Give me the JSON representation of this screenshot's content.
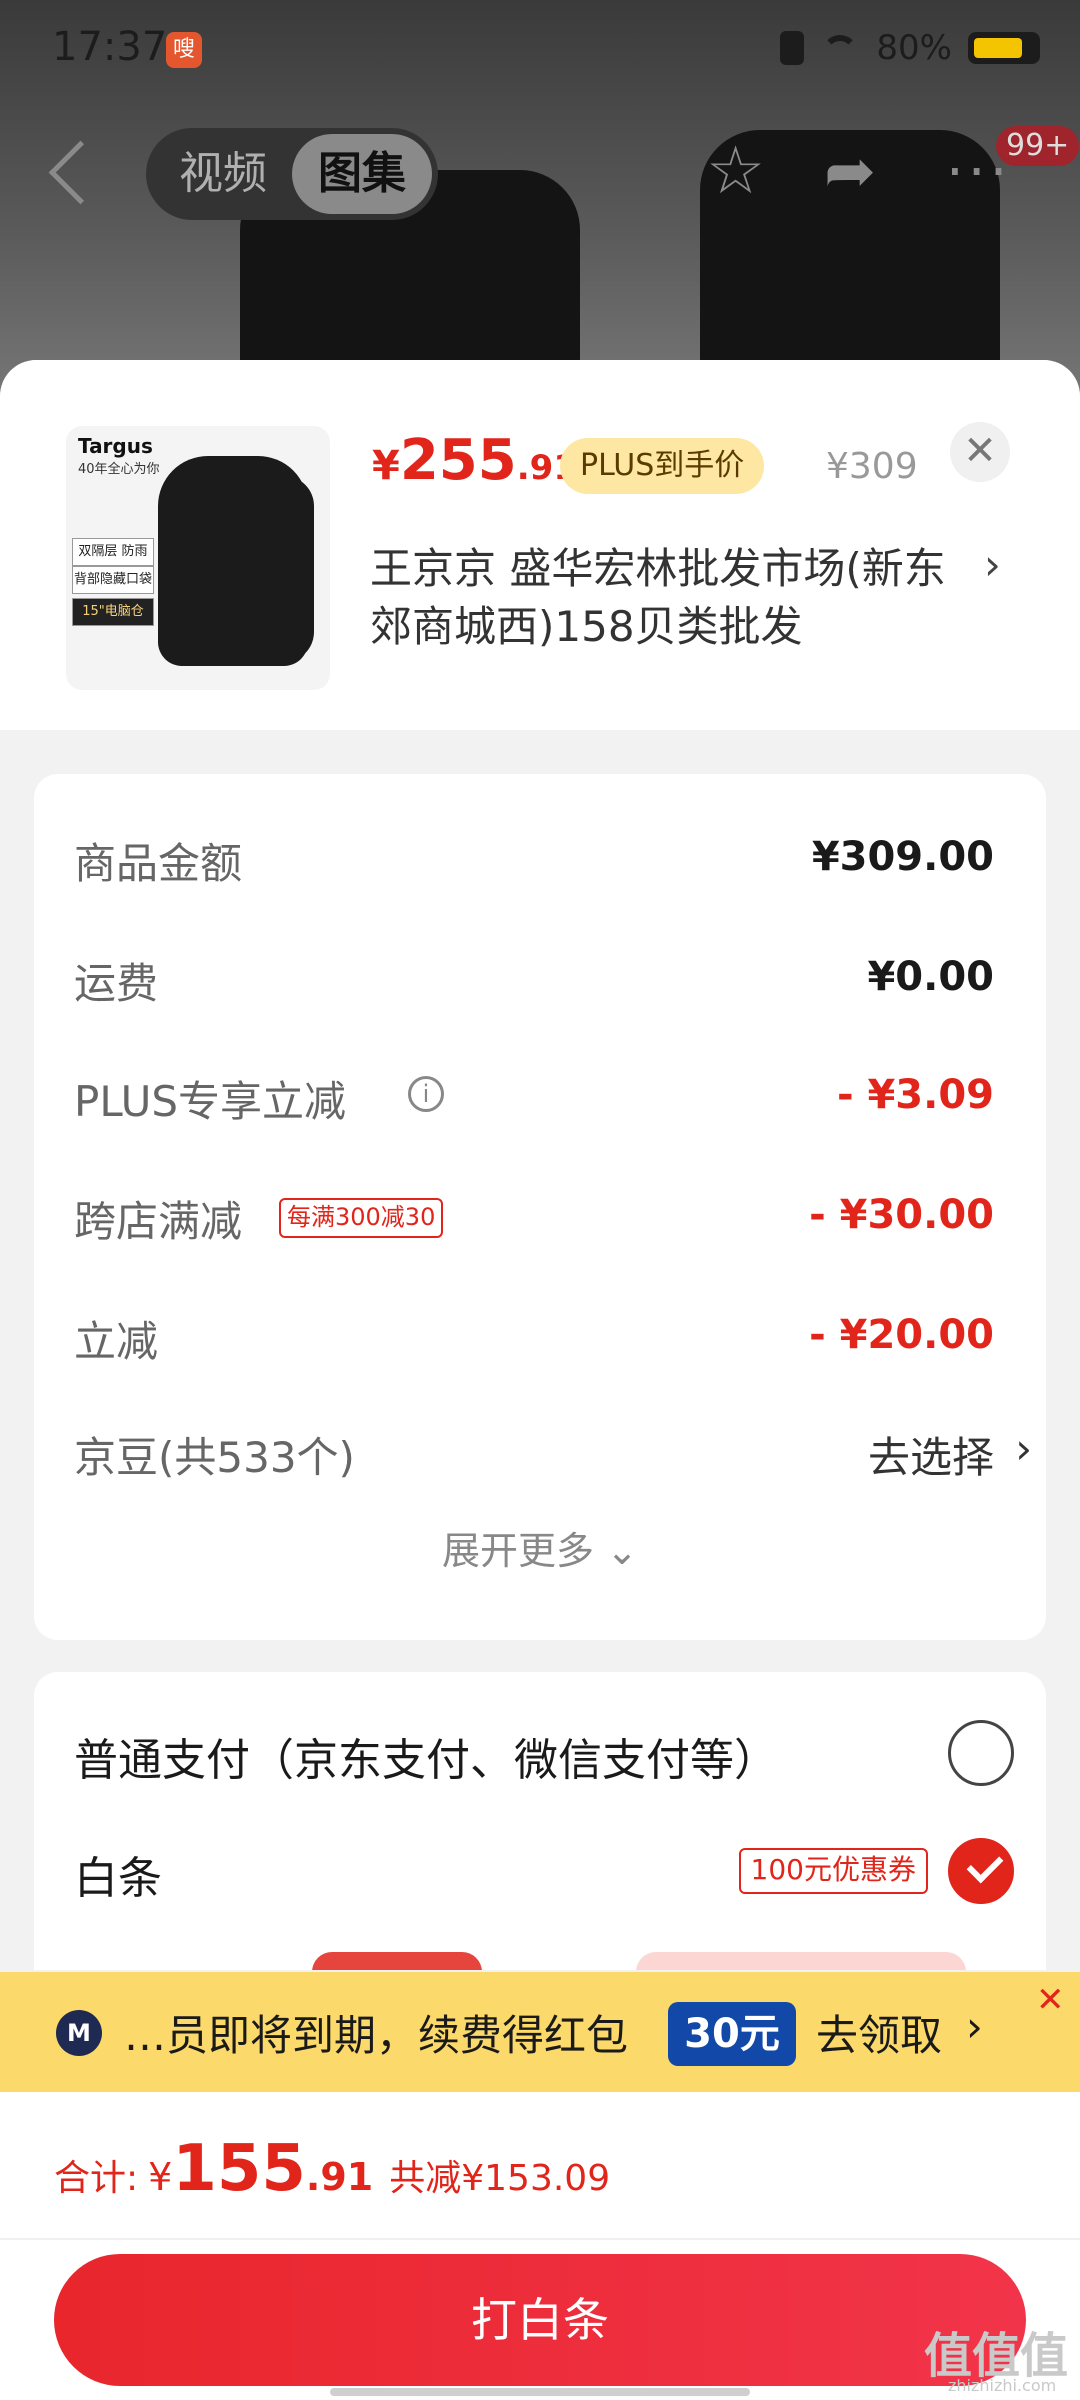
{
  "status_bar": {
    "time": "17:37",
    "app_badge": "嗖",
    "battery": "80%",
    "battery_level": 0.8
  },
  "nav": {
    "tabs": [
      "视频",
      "图集"
    ],
    "active_tab": "图集",
    "badge": "99+"
  },
  "product": {
    "price_symbol": "¥",
    "price_int": "255",
    "price_dec": ".91",
    "plus_tag": "PLUS到手价",
    "original_price": "¥309",
    "shop_name": "王京京  盛华宏林批发市场(新东郊商城西)158贝类批发",
    "image": {
      "brand": "Targus",
      "slogan": "40年全心为你",
      "tags": [
        "双隔层 防雨罩",
        "背部隐藏口袋",
        "15\"电脑仓"
      ]
    }
  },
  "fees": {
    "rows": [
      {
        "label": "商品金额",
        "value": "¥309.00"
      },
      {
        "label": "运费",
        "value": "¥0.00"
      },
      {
        "label": "PLUS专享立减",
        "value": "- ¥3.09"
      },
      {
        "label": "跨店满减",
        "tag": "每满300减30",
        "value": "- ¥30.00"
      },
      {
        "label": "立减",
        "value": "- ¥20.00"
      },
      {
        "label": "京豆(共533个)",
        "value": "去选择"
      }
    ],
    "expand_label": "展开更多"
  },
  "payment": {
    "options": [
      {
        "label": "普通支付（京东支付、微信支付等）",
        "selected": false
      },
      {
        "label": "白条",
        "coupon": "100元优惠券",
        "selected": true
      }
    ]
  },
  "banner": {
    "text": "…员即将到期，续费得红包",
    "coupon": "30元",
    "cta": "去领取"
  },
  "footer": {
    "total_label": "合计:",
    "total_symbol": "¥",
    "total_int": "155",
    "total_dec": ".91",
    "total_discount": "共减¥153.09",
    "pay_button": "打白条"
  },
  "watermark": {
    "main": "值值值",
    "sub": "zhizhizhi.com"
  },
  "colors": {
    "accent": "#e1251b",
    "plus_tag_bg": "#fde7a3",
    "banner_bg": "#fbd96a",
    "banner_coupon_bg": "#1249a8"
  }
}
